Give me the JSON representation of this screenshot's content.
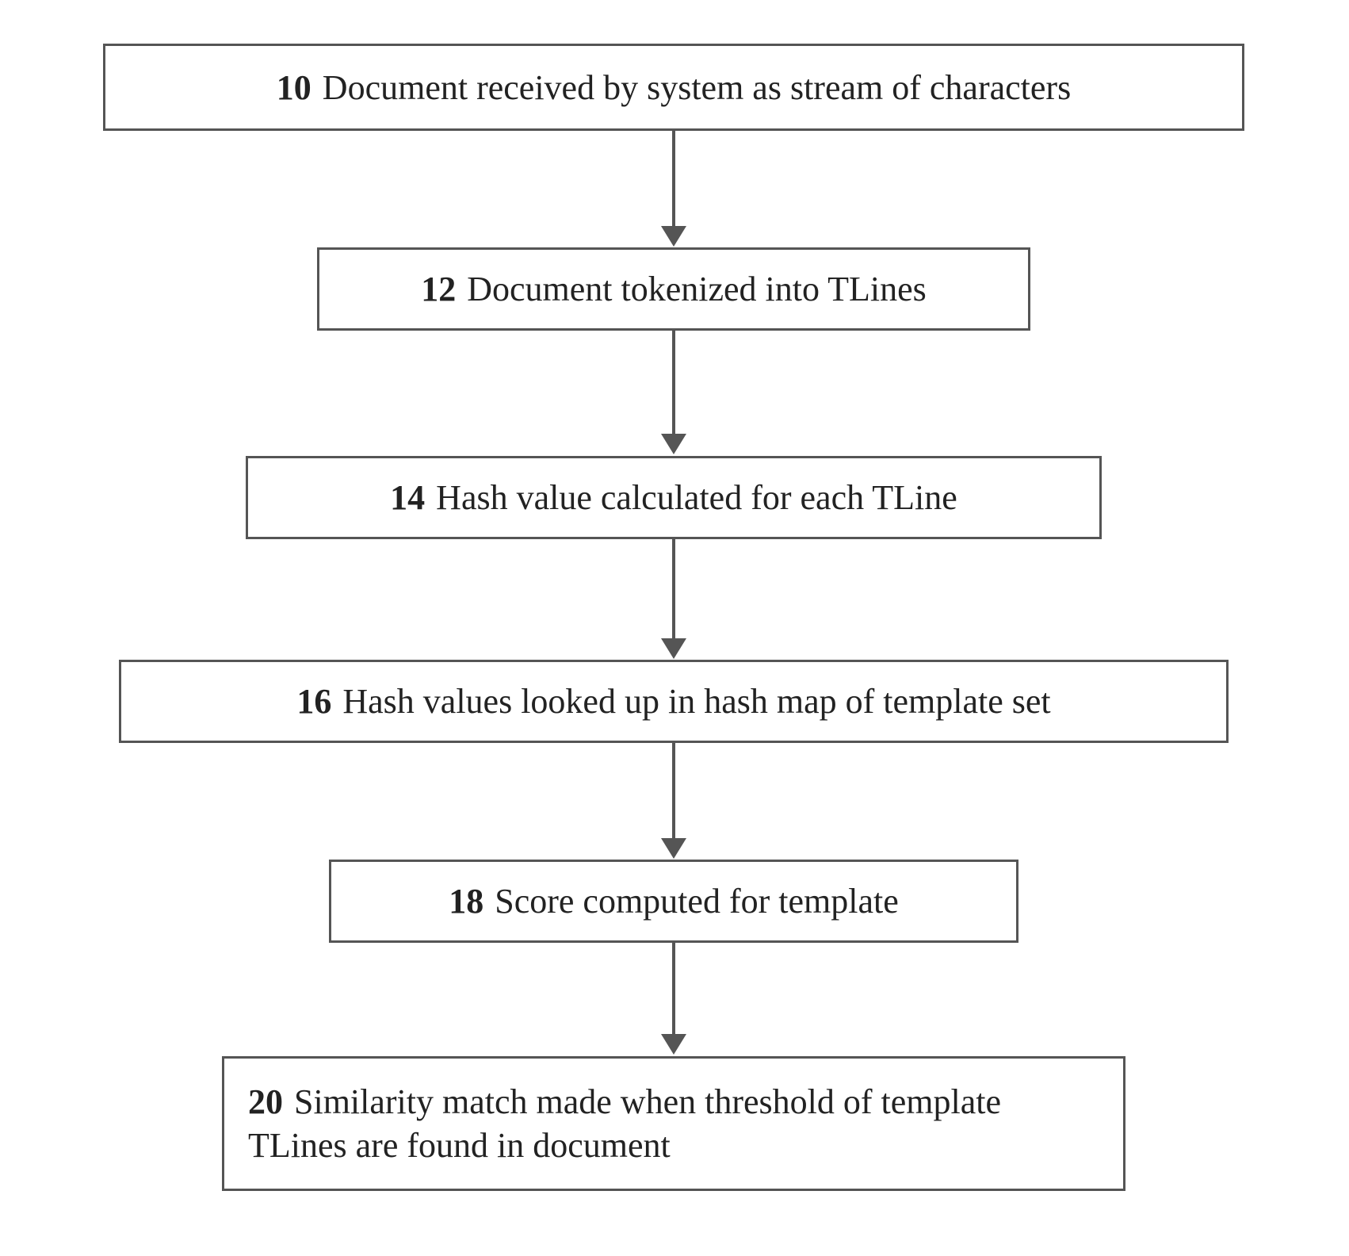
{
  "chart_data": {
    "type": "flowchart",
    "direction": "top-to-bottom",
    "nodes": [
      {
        "id": "10",
        "label": "Document received by system as stream of characters"
      },
      {
        "id": "12",
        "label": "Document tokenized into TLines"
      },
      {
        "id": "14",
        "label": "Hash value calculated for each TLine"
      },
      {
        "id": "16",
        "label": "Hash values looked up in hash map of template set"
      },
      {
        "id": "18",
        "label": "Score computed for template"
      },
      {
        "id": "20",
        "label": "Similarity match made when threshold of template TLines are found in document"
      }
    ],
    "edges": [
      {
        "from": "10",
        "to": "12"
      },
      {
        "from": "12",
        "to": "14"
      },
      {
        "from": "14",
        "to": "16"
      },
      {
        "from": "16",
        "to": "18"
      },
      {
        "from": "18",
        "to": "20"
      }
    ]
  },
  "flow": {
    "steps": [
      {
        "num": "10",
        "text": "Document received by system as stream of characters"
      },
      {
        "num": "12",
        "text": "Document tokenized into TLines"
      },
      {
        "num": "14",
        "text": "Hash value calculated for each TLine"
      },
      {
        "num": "16",
        "text": "Hash values looked up in hash map of template set"
      },
      {
        "num": "18",
        "text": "Score computed for template"
      },
      {
        "num": "20",
        "text": "Similarity match made when threshold of template TLines are found in document"
      }
    ]
  }
}
